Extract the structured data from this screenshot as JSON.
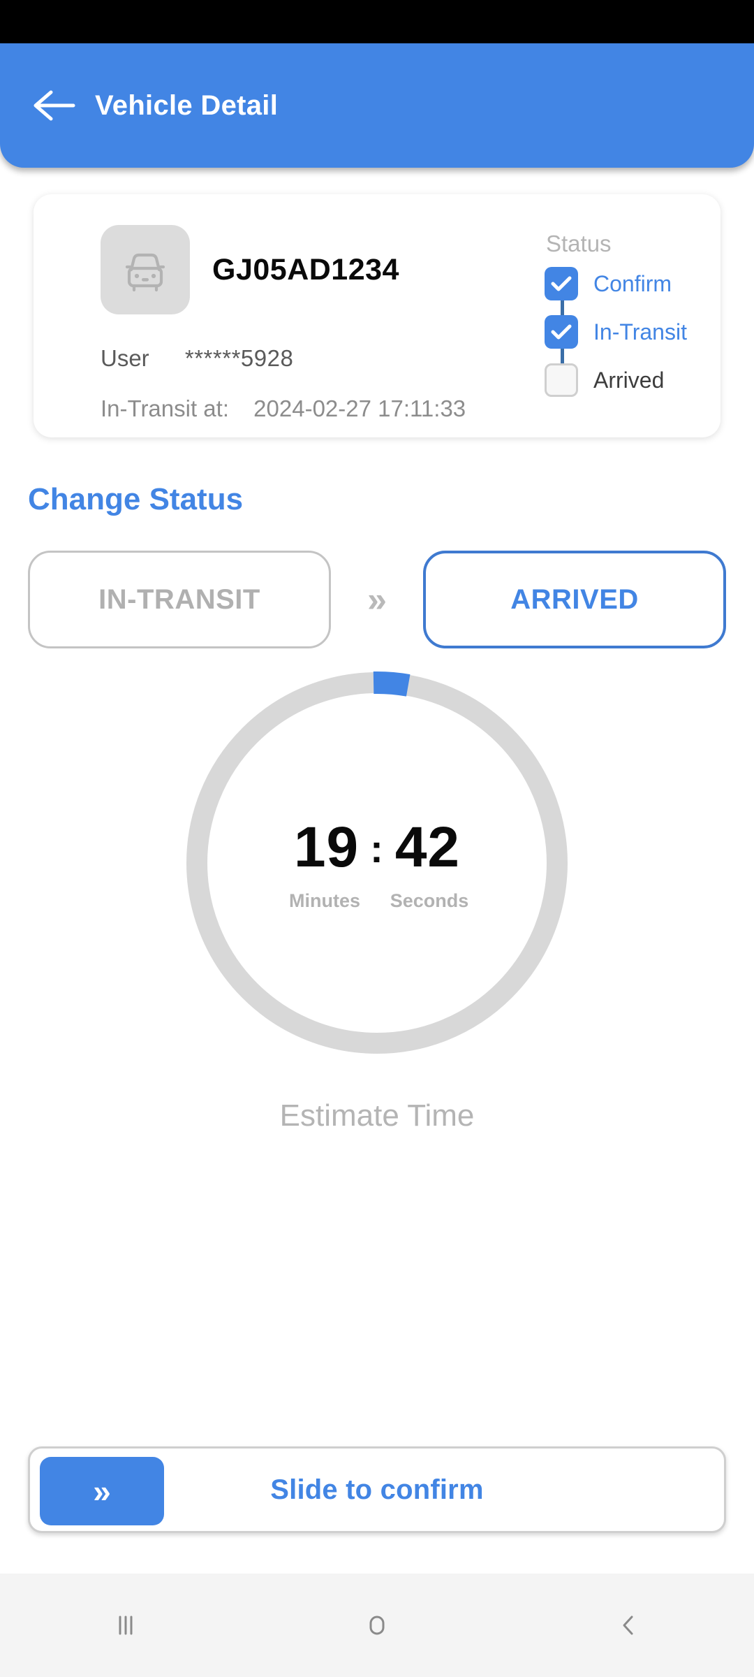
{
  "app_bar": {
    "title": "Vehicle Detail",
    "back_icon": "arrow-left-icon",
    "background_color": "#4285E4"
  },
  "vehicle_card": {
    "vehicle_icon": "car-front-icon",
    "vehicle_number": "GJ05AD1234",
    "user_label": "User",
    "user_value": "******5928",
    "transit_label": "In-Transit at:",
    "transit_value": "2024-02-27 17:11:33"
  },
  "status_timeline": {
    "title": "Status",
    "items": [
      {
        "label": "Confirm",
        "checked": true,
        "state": "active"
      },
      {
        "label": "In-Transit",
        "checked": true,
        "state": "active"
      },
      {
        "label": "Arrived",
        "checked": false,
        "state": "inactive"
      }
    ],
    "checked_color": "#4285E4",
    "connector_color": "#3A6EA8"
  },
  "change_status": {
    "heading": "Change Status",
    "from_label": "IN-TRANSIT",
    "separator": "»",
    "to_label": "ARRIVED",
    "from_color": "#B0B0B0",
    "to_color": "#4285E4"
  },
  "timer": {
    "minutes": "19",
    "colon": ":",
    "seconds": "42",
    "minutes_unit": "Minutes",
    "seconds_unit": "Seconds",
    "caption": "Estimate Time",
    "progress_percent": 3,
    "track_color": "#D8D8D8",
    "progress_color": "#4285E4"
  },
  "slide_confirm": {
    "handle_icon": "double-chevron-right-icon",
    "handle_glyph": "»",
    "label": "Slide to confirm",
    "handle_color": "#4285E4"
  },
  "nav_bar": {
    "recents": "recents-icon",
    "home": "home-icon",
    "back": "back-icon"
  }
}
